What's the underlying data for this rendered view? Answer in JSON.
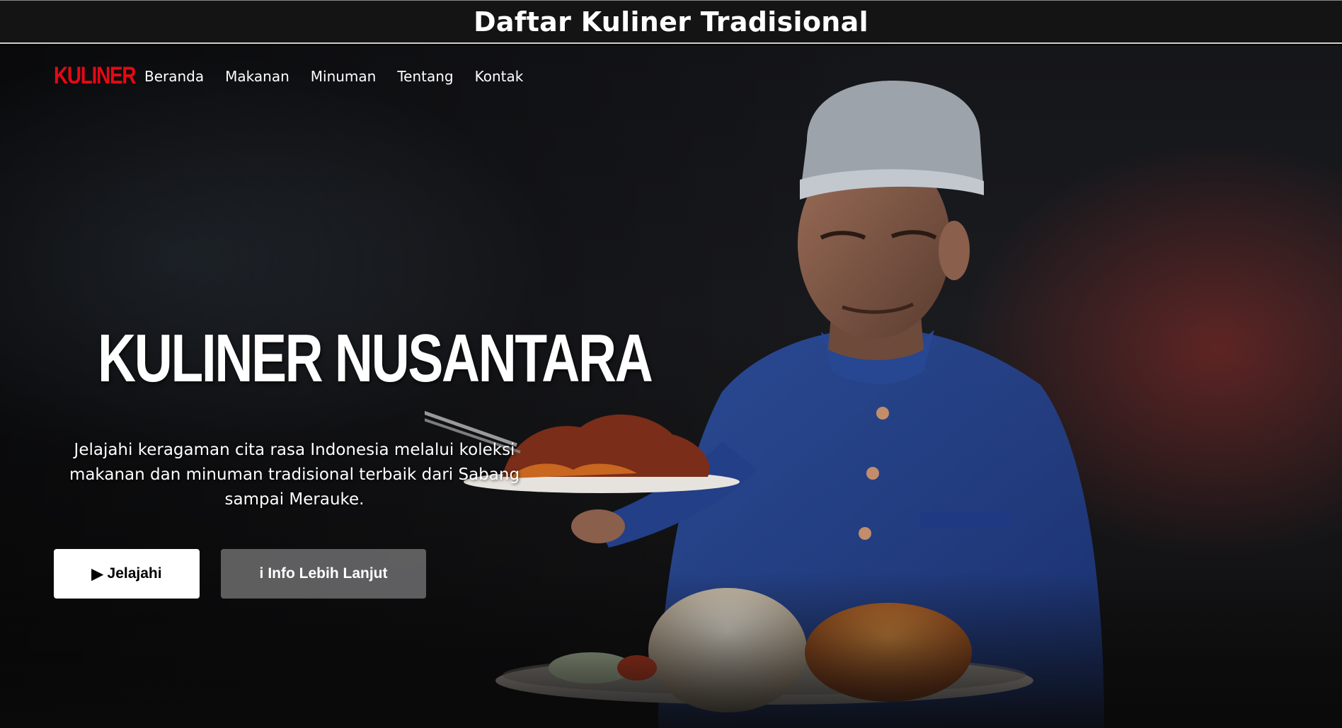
{
  "page_header": {
    "title": "Daftar Kuliner Tradisional"
  },
  "navbar": {
    "brand": "KULINER",
    "links": [
      "Beranda",
      "Makanan",
      "Minuman",
      "Tentang",
      "Kontak"
    ]
  },
  "hero": {
    "title": "KULINER NUSANTARA",
    "description": "Jelajahi keragaman cita rasa Indonesia melalui koleksi makanan dan minuman tradisional terbaik dari Sabang sampai Merauke.",
    "primary_button": {
      "icon": "▶",
      "label": "Jelajahi"
    },
    "secondary_button": {
      "icon": "i",
      "label": "Info Lebih Lanjut"
    }
  },
  "colors": {
    "brand_red": "#e50914",
    "header_bg": "#141414",
    "play_button_bg": "#ffffff",
    "info_button_bg": "#6d6d6e"
  }
}
